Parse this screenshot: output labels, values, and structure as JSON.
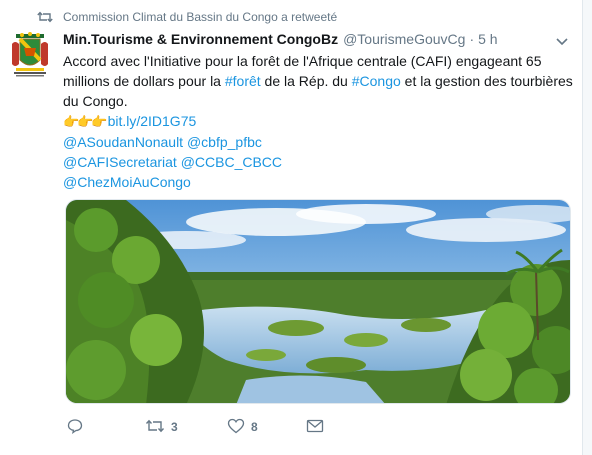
{
  "retweet_context": {
    "icon": "retweet-icon",
    "text": "Commission Climat du Bassin du Congo a retweeté"
  },
  "tweet": {
    "author_name": "Min.Tourisme & Environnement CongoBz",
    "author_handle": "@TourismeGouvCg",
    "separator": "·",
    "time": "5 h",
    "text_part1": "Accord avec l'Initiative pour la forêt de l'Afrique centrale (CAFI) engageant 65 millions de dollars pour la ",
    "hashtag_foret": "#forêt",
    "text_part2": " de la Rép. du ",
    "hashtag_congo": "#Congo",
    "text_part3": " et la gestion des tourbières du Congo.",
    "emoji": "👉👉👉",
    "link": "bit.ly/2ID1G75",
    "mentions_line1": "@ASoudanNonault @cbfp_pfbc",
    "mentions_line2": "@CAFISecretariat @CCBC_CBCC",
    "mentions_line3": "@ChezMoiAuCongo"
  },
  "actions": {
    "reply_icon": "reply-icon",
    "retweet_icon": "retweet-icon",
    "retweet_count": "3",
    "like_icon": "heart-icon",
    "like_count": "8",
    "dm_icon": "envelope-icon"
  },
  "colors": {
    "link": "#1b95e0",
    "secondary_text": "#657786",
    "primary_text": "#14171a"
  }
}
